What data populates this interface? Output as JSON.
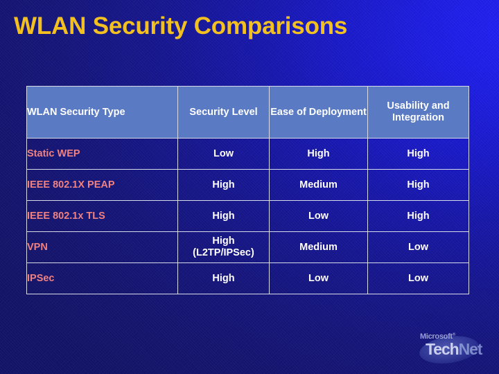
{
  "slide": {
    "title": "WLAN Security Comparisons",
    "title_color": "#f2c021",
    "background_dark": "#14146e",
    "background_bright": "#2020f0"
  },
  "table": {
    "header_background": "#5a7ac4",
    "header_text_color": "#ffffff",
    "row_label_color": "#f08181",
    "cell_text_color": "#ffffff",
    "border_color": "#d8dce8",
    "columns": [
      "WLAN Security Type",
      "Security Level",
      "Ease of Deployment",
      "Usability and Integration"
    ],
    "rows": [
      {
        "type": "Static WEP",
        "security_level": "Low",
        "ease_of_deployment": "High",
        "usability_and_integration": "High"
      },
      {
        "type": "IEEE 802.1X PEAP",
        "security_level": "High",
        "ease_of_deployment": "Medium",
        "usability_and_integration": "High"
      },
      {
        "type": "IEEE 802.1x TLS",
        "security_level": "High",
        "ease_of_deployment": "Low",
        "usability_and_integration": "High"
      },
      {
        "type": "VPN",
        "security_level": "High\n(L2TP/IPSec)",
        "security_level_line1": "High",
        "security_level_line2": "(L2TP/IPSec)",
        "ease_of_deployment": "Medium",
        "usability_and_integration": "Low"
      },
      {
        "type": "IPSec",
        "security_level": "High",
        "ease_of_deployment": "Low",
        "usability_and_integration": "Low"
      }
    ]
  },
  "logo": {
    "brand": "Microsoft",
    "registered_mark": "®",
    "product_part1": "Tech",
    "product_part2": "Net"
  }
}
